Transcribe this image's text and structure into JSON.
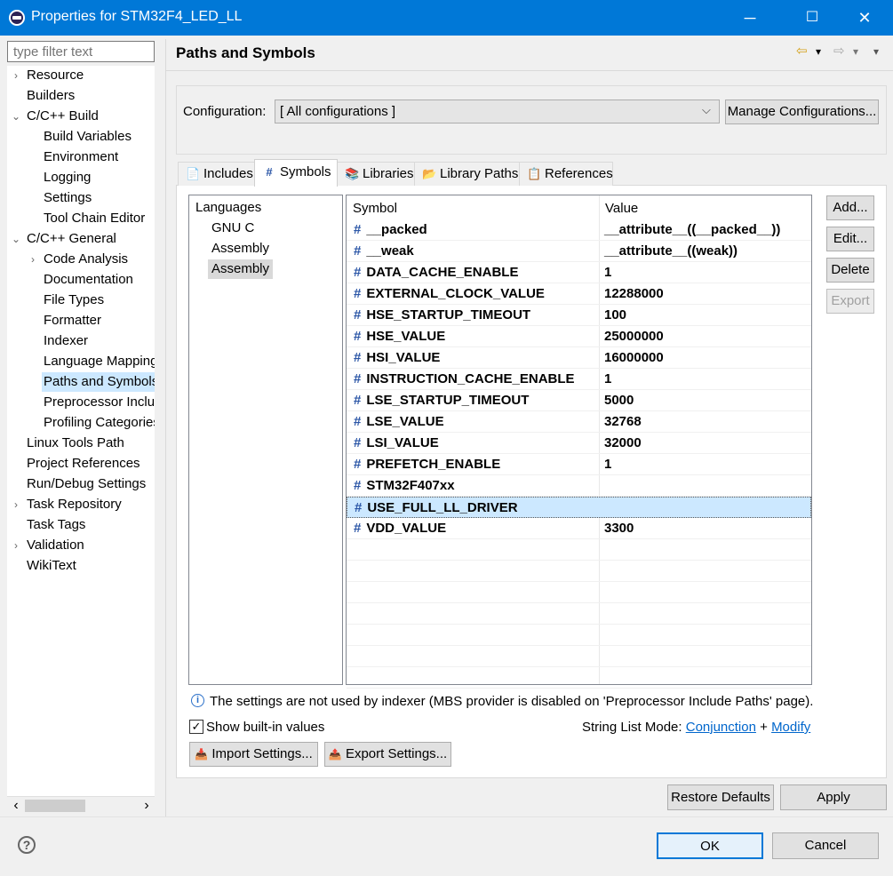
{
  "window": {
    "title": "Properties for STM32F4_LED_LL",
    "minimize_glyph": "─",
    "maximize_glyph": "☐",
    "close_glyph": "✕"
  },
  "filter": {
    "placeholder": "type filter text"
  },
  "tree": {
    "twisty_collapsed": "›",
    "twisty_expanded": "⌄",
    "items": [
      {
        "label": "Resource",
        "twisty": "collapsed"
      },
      {
        "label": "Builders"
      },
      {
        "label": "C/C++ Build",
        "twisty": "expanded"
      },
      {
        "label": "Build Variables"
      },
      {
        "label": "Environment"
      },
      {
        "label": "Logging"
      },
      {
        "label": "Settings"
      },
      {
        "label": "Tool Chain Editor"
      },
      {
        "label": "C/C++ General",
        "twisty": "expanded"
      },
      {
        "label": "Code Analysis",
        "twisty": "collapsed"
      },
      {
        "label": "Documentation"
      },
      {
        "label": "File Types"
      },
      {
        "label": "Formatter"
      },
      {
        "label": "Indexer"
      },
      {
        "label": "Language Mappings"
      },
      {
        "label": "Paths and Symbols",
        "selected": true
      },
      {
        "label": "Preprocessor Include Paths"
      },
      {
        "label": "Profiling Categories"
      },
      {
        "label": "Linux Tools Path"
      },
      {
        "label": "Project References"
      },
      {
        "label": "Run/Debug Settings"
      },
      {
        "label": "Task Repository",
        "twisty": "collapsed"
      },
      {
        "label": "Task Tags"
      },
      {
        "label": "Validation",
        "twisty": "collapsed"
      },
      {
        "label": "WikiText"
      }
    ],
    "scroll_left_glyph": "‹",
    "scroll_right_glyph": "›"
  },
  "page": {
    "title": "Paths and Symbols",
    "nav_back_glyph": "⇦",
    "nav_forward_glyph": "⇨",
    "nav_menu_glyph": "▾"
  },
  "configuration": {
    "label": "Configuration:",
    "value": "[ All configurations ]",
    "combo_arrow": "⌵",
    "manage_button": "Manage Configurations..."
  },
  "tabs": [
    {
      "label": "Includes",
      "icon": "📄"
    },
    {
      "label": "Symbols",
      "icon": "#",
      "active": true
    },
    {
      "label": "Libraries",
      "icon": "📚"
    },
    {
      "label": "Library Paths",
      "icon": "📂"
    },
    {
      "label": "References",
      "icon": "📋"
    }
  ],
  "languages": {
    "header": "Languages",
    "items": [
      {
        "label": "GNU C"
      },
      {
        "label": "Assembly"
      },
      {
        "label": "Assembly",
        "selected": true
      }
    ]
  },
  "symbols_table": {
    "col_symbol": "Symbol",
    "col_value": "Value",
    "hash_glyph": "#",
    "rows": [
      {
        "symbol": "__packed",
        "value": "__attribute__((__packed__))"
      },
      {
        "symbol": "__weak",
        "value": "__attribute__((weak))"
      },
      {
        "symbol": "DATA_CACHE_ENABLE",
        "value": "1"
      },
      {
        "symbol": "EXTERNAL_CLOCK_VALUE",
        "value": "12288000"
      },
      {
        "symbol": "HSE_STARTUP_TIMEOUT",
        "value": "100"
      },
      {
        "symbol": "HSE_VALUE",
        "value": "25000000"
      },
      {
        "symbol": "HSI_VALUE",
        "value": "16000000"
      },
      {
        "symbol": "INSTRUCTION_CACHE_ENABLE",
        "value": "1"
      },
      {
        "symbol": "LSE_STARTUP_TIMEOUT",
        "value": "5000"
      },
      {
        "symbol": "LSE_VALUE",
        "value": "32768"
      },
      {
        "symbol": "LSI_VALUE",
        "value": "32000"
      },
      {
        "symbol": "PREFETCH_ENABLE",
        "value": "1"
      },
      {
        "symbol": "STM32F407xx",
        "value": ""
      },
      {
        "symbol": "USE_FULL_LL_DRIVER",
        "value": "",
        "selected": true
      },
      {
        "symbol": "VDD_VALUE",
        "value": "3300"
      }
    ]
  },
  "side_buttons": {
    "add": "Add...",
    "edit": "Edit...",
    "delete": "Delete",
    "export": "Export"
  },
  "info": {
    "icon_glyph": "i",
    "text": "The settings are not used by indexer (MBS provider is disabled on 'Preprocessor Include Paths' page)."
  },
  "show_builtin": {
    "label": "Show built-in values",
    "checked": true,
    "check_glyph": "✓"
  },
  "string_list_mode": {
    "label": "String List Mode:",
    "conjunction": "Conjunction",
    "plus": "+",
    "modify": "Modify"
  },
  "import_settings": {
    "label": "Import Settings...",
    "icon": "📥"
  },
  "export_settings": {
    "label": "Export Settings...",
    "icon": "📤"
  },
  "restore_defaults": "Restore Defaults",
  "apply": "Apply",
  "ok": "OK",
  "cancel": "Cancel",
  "help_glyph": "?"
}
